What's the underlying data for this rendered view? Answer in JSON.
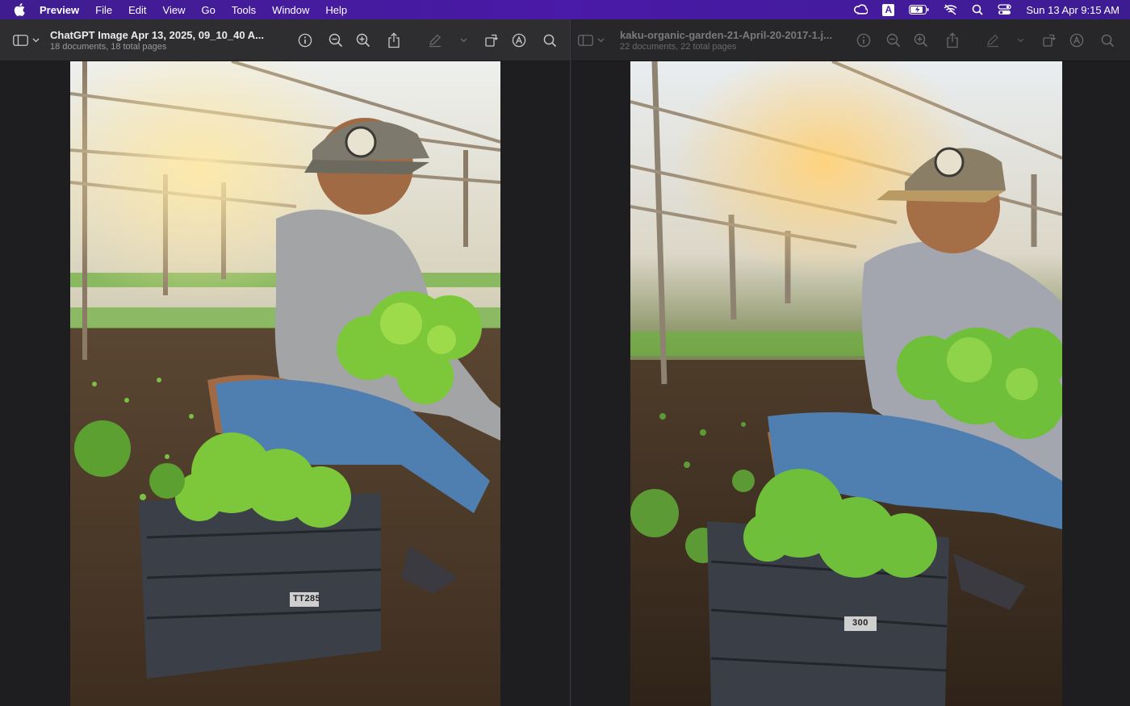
{
  "menubar": {
    "app_name": "Preview",
    "items": [
      "File",
      "Edit",
      "View",
      "Go",
      "Tools",
      "Window",
      "Help"
    ],
    "status_icons": [
      "creative-cloud-icon",
      "input-source-icon",
      "battery-icon",
      "wifi-off-icon",
      "spotlight-search-icon",
      "control-center-icon"
    ],
    "input_source_letter": "A",
    "clock": "Sun 13 Apr  9:15 AM"
  },
  "windows": [
    {
      "title": "ChatGPT Image Apr 13, 2025, 09_10_40 A...",
      "subtitle": "18 documents, 18 total pages",
      "image_label": "TT285",
      "active": true
    },
    {
      "title": "kaku-organic-garden-21-April-20-2017-1.j...",
      "subtitle": "22 documents, 22 total pages",
      "image_label": "300",
      "active": false
    }
  ],
  "colors": {
    "menubar": "#4a1aa8",
    "titlebar_active": "#2e2e31",
    "titlebar_inactive": "#272729",
    "canvas": "#1e1e20"
  }
}
